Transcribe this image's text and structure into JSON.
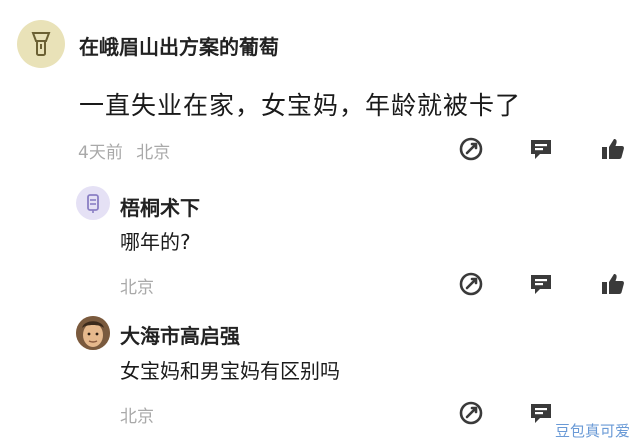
{
  "main_comment": {
    "username": "在峨眉山出方案的葡萄",
    "text": "一直失业在家，女宝妈，年龄就被卡了",
    "time": "4天前",
    "location": "北京"
  },
  "replies": [
    {
      "username": "梧桐术下",
      "text": "哪年的?",
      "location": "北京"
    },
    {
      "username": "大海市高启强",
      "text": "女宝妈和男宝妈有区别吗",
      "location": "北京"
    }
  ],
  "watermark": "豆包真可爱",
  "icons": {
    "share": "share-edit-icon",
    "comment": "comment-bubble-icon",
    "like": "thumbs-up-icon"
  },
  "colors": {
    "text": "#1a1a1a",
    "meta": "#a9a9a9",
    "icon": "#3a3a3a",
    "watermark": "#6a9ad6"
  }
}
